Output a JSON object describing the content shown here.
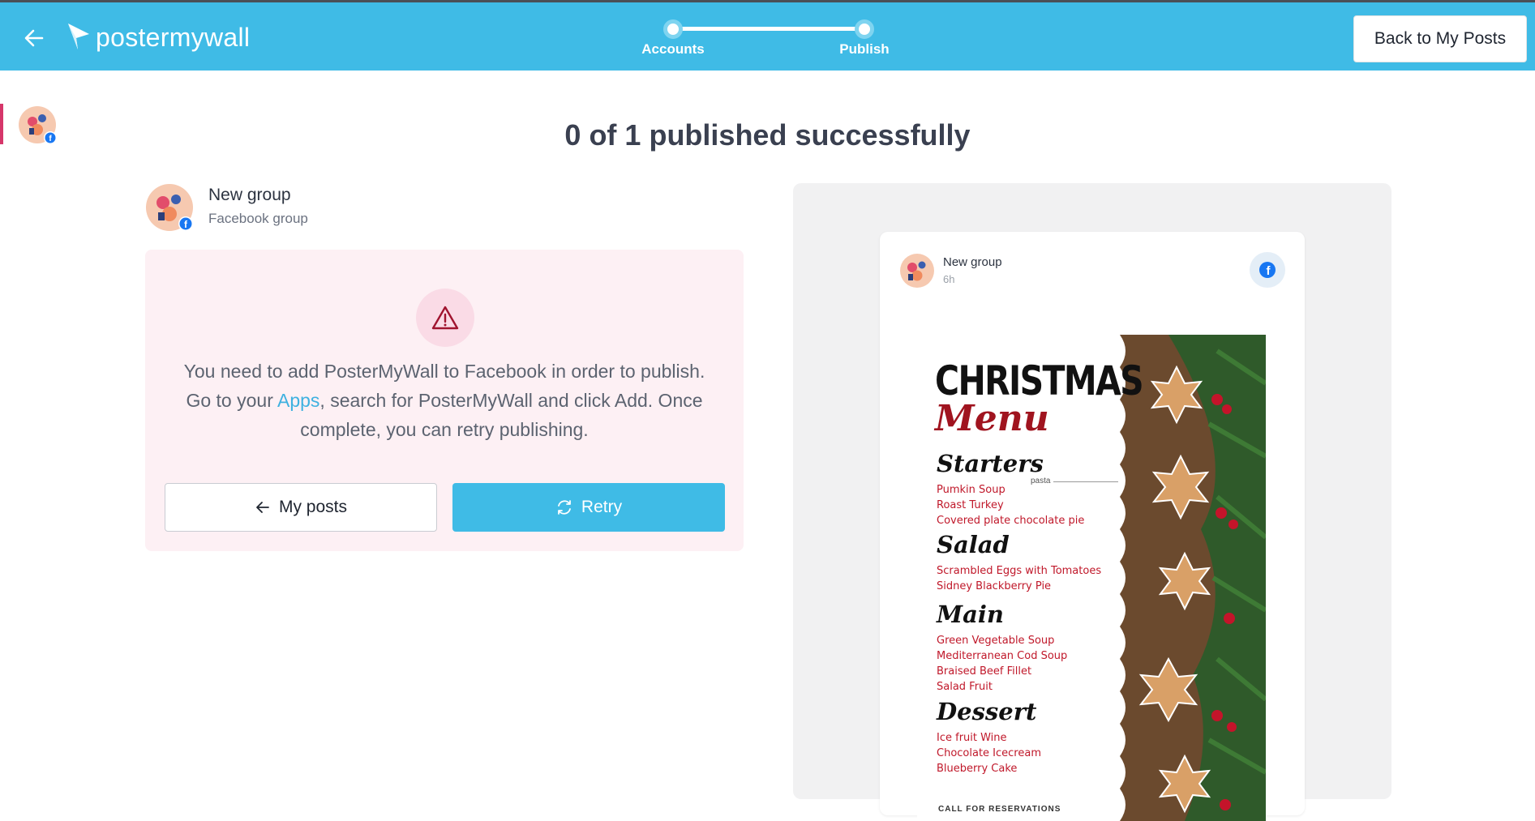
{
  "header": {
    "logo_text": "postermywall",
    "steps": [
      {
        "label": "Accounts"
      },
      {
        "label": "Publish"
      }
    ],
    "back_button_label": "Back to My Posts"
  },
  "status": {
    "headline": "0 of 1 published successfully"
  },
  "account": {
    "name": "New group",
    "type": "Facebook group"
  },
  "error": {
    "message_before_link": "You need to add PosterMyWall to Facebook in order to publish. Go to your ",
    "link_text": "Apps",
    "message_after_link": ", search for PosterMyWall and click Add. Once complete, you can retry publishing.",
    "my_posts_label": "My posts",
    "retry_label": "Retry"
  },
  "preview": {
    "account_name": "New group",
    "time": "6h",
    "poster": {
      "title": "CHRISTMAS",
      "subtitle": "Menu",
      "pasta_label": "pasta",
      "sections": [
        {
          "heading": "Starters",
          "items": [
            "Pumkin Soup",
            "Roast Turkey",
            "Covered plate chocolate pie"
          ]
        },
        {
          "heading": "Salad",
          "items": [
            "Scrambled Eggs with Tomatoes",
            "Sidney Blackberry Pie"
          ]
        },
        {
          "heading": "Main",
          "items": [
            "Green Vegetable Soup",
            "Mediterranean Cod Soup",
            "Braised Beef Fillet",
            "Salad Fruit"
          ]
        },
        {
          "heading": "Dessert",
          "items": [
            "Ice fruit Wine",
            "Chocolate Icecream",
            "Blueberry Cake"
          ]
        }
      ],
      "footer": "CALL FOR RESERVATIONS"
    }
  },
  "colors": {
    "brand": "#3fbbe6",
    "error_bg": "#fdf0f4",
    "warning": "#a0142f",
    "link": "#3fb1e0",
    "facebook": "#1877f2"
  }
}
